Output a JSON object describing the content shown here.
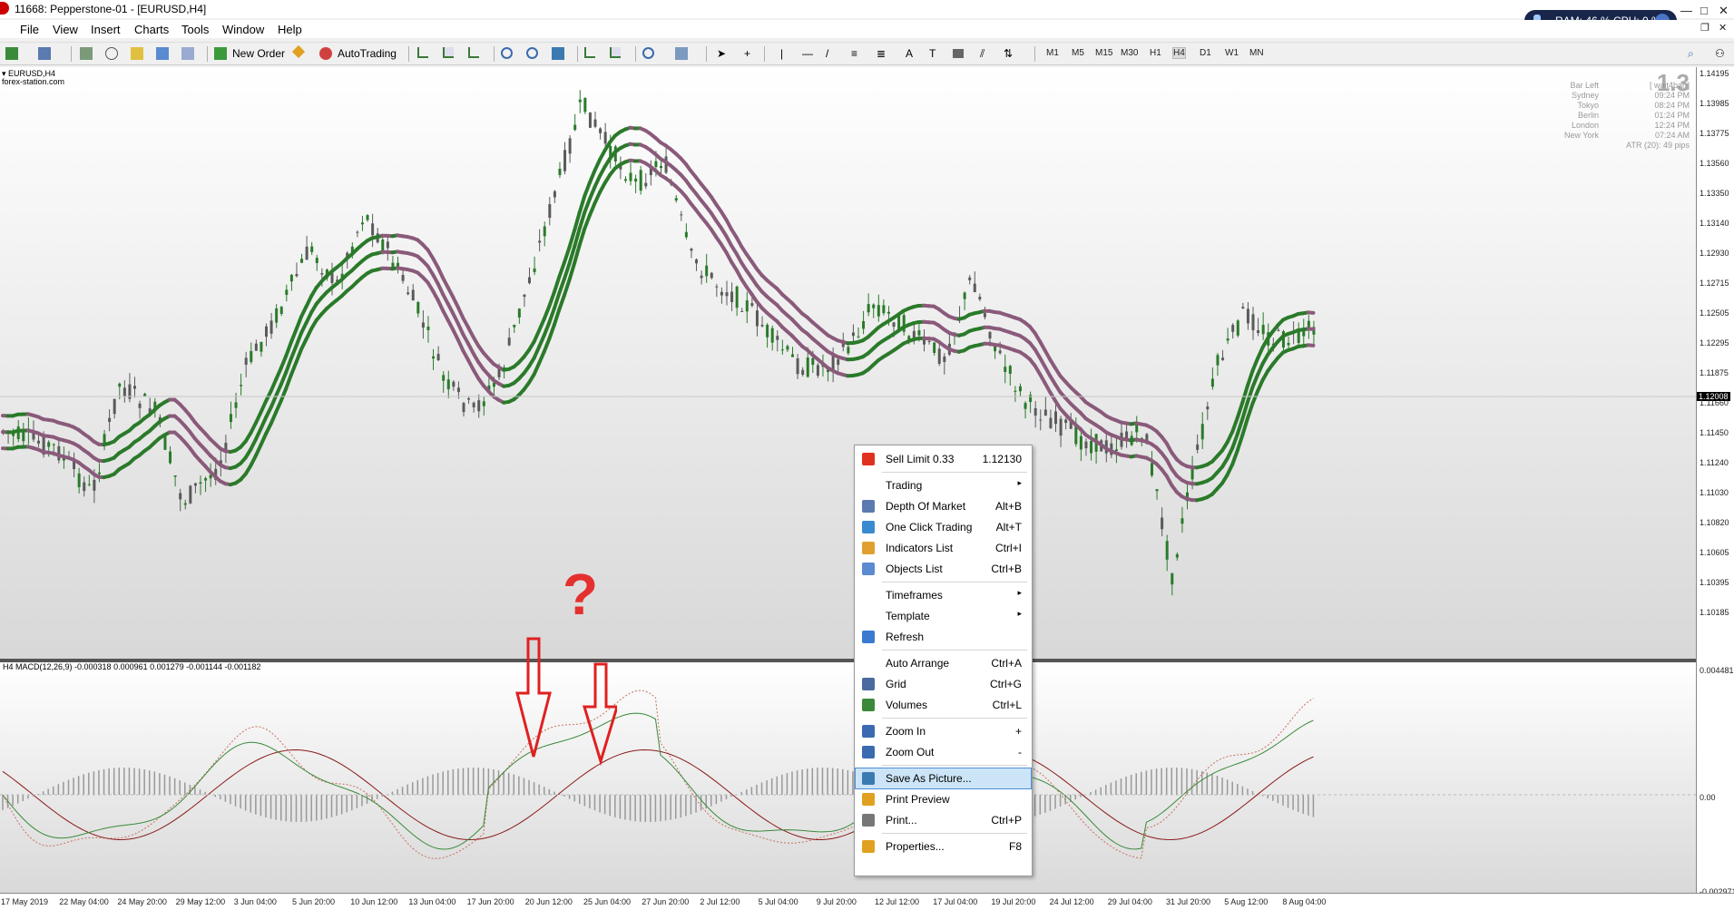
{
  "titlebar": {
    "title": "11668: Pepperstone-01 - [EURUSD,H4]"
  },
  "menu": [
    "File",
    "View",
    "Insert",
    "Charts",
    "Tools",
    "Window",
    "Help"
  ],
  "sysmon": {
    "text": "RAM: 46 %  CPU: 0 %",
    "arrow": "→"
  },
  "toolbar": {
    "new_order": "New Order",
    "auto_trading": "AutoTrading",
    "timeframes": [
      "M1",
      "M5",
      "M15",
      "M30",
      "H1",
      "H4",
      "D1",
      "W1",
      "MN"
    ],
    "active_tf": "H4"
  },
  "chart": {
    "symbol": "EURUSD,H4",
    "site": "forex-station.com",
    "macd_label": "H4 MACD(12,26,9) -0.000318 0.000961 0.001279 -0.001144 -0.001182",
    "big_value": "1.3",
    "info": [
      {
        "k": "Bar Left",
        "v": "[ wait4bar ]"
      },
      {
        "k": "Sydney",
        "v": "09:24 PM"
      },
      {
        "k": "Tokyo",
        "v": "08:24 PM"
      },
      {
        "k": "Berlin",
        "v": "01:24 PM"
      },
      {
        "k": "London",
        "v": "12:24 PM"
      },
      {
        "k": "New York",
        "v": "07:24 AM"
      },
      {
        "k": "",
        "v": "ATR (20): 49 pips"
      }
    ],
    "price_axis": [
      "1.14195",
      "1.13985",
      "1.13775",
      "1.13560",
      "1.13350",
      "1.13140",
      "1.12930",
      "1.12715",
      "1.12505",
      "1.12295",
      "1.12008",
      "1.11875",
      "1.11660",
      "1.11450",
      "1.11240",
      "1.11030",
      "1.10820",
      "1.10605",
      "1.10395",
      "1.10185"
    ],
    "current_price": "1.12008",
    "macd_axis": [
      "0.004481",
      "0.00",
      "-0.002971"
    ],
    "time_axis": [
      "17 May 2019",
      "22 May 04:00",
      "24 May 20:00",
      "29 May 12:00",
      "3 Jun 04:00",
      "5 Jun 20:00",
      "10 Jun 12:00",
      "13 Jun 04:00",
      "17 Jun 20:00",
      "20 Jun 12:00",
      "25 Jun 04:00",
      "27 Jun 20:00",
      "2 Jul 12:00",
      "5 Jul 04:00",
      "9 Jul 20:00",
      "12 Jul 12:00",
      "17 Jul 04:00",
      "19 Jul 20:00",
      "24 Jul 12:00",
      "29 Jul 04:00",
      "31 Jul 20:00",
      "5 Aug 12:00",
      "8 Aug 04:00"
    ],
    "annotation": "?",
    "colors": {
      "green": "#2a7a2a",
      "maroon": "#8a5a7a",
      "arrow": "#e02020",
      "macd_main": "#3a8a3a",
      "macd_signal": "#8a1a1a"
    }
  },
  "context_menu": {
    "items": [
      {
        "label": "Sell Limit 0.33",
        "shortcut": "1.12130",
        "icon": "sell-arrow-icon"
      },
      {
        "sep": true
      },
      {
        "label": "Trading",
        "submenu": true
      },
      {
        "label": "Depth Of Market",
        "shortcut": "Alt+B",
        "icon": "depth-of-market-icon"
      },
      {
        "label": "One Click Trading",
        "shortcut": "Alt+T",
        "icon": "one-click-trading-icon"
      },
      {
        "label": "Indicators List",
        "shortcut": "Ctrl+I",
        "icon": "indicators-list-icon"
      },
      {
        "label": "Objects List",
        "shortcut": "Ctrl+B",
        "icon": "objects-list-icon"
      },
      {
        "sep": true
      },
      {
        "label": "Timeframes",
        "submenu": true
      },
      {
        "label": "Template",
        "submenu": true
      },
      {
        "label": "Refresh",
        "icon": "refresh-icon"
      },
      {
        "sep": true
      },
      {
        "label": "Auto Arrange",
        "shortcut": "Ctrl+A"
      },
      {
        "label": "Grid",
        "shortcut": "Ctrl+G",
        "icon": "grid-icon"
      },
      {
        "label": "Volumes",
        "shortcut": "Ctrl+L",
        "icon": "volumes-icon"
      },
      {
        "sep": true
      },
      {
        "label": "Zoom In",
        "shortcut": "+",
        "icon": "zoom-in-icon"
      },
      {
        "label": "Zoom Out",
        "shortcut": "-",
        "icon": "zoom-out-icon"
      },
      {
        "sep": true
      },
      {
        "label": "Save As Picture...",
        "highlight": true,
        "icon": "save-picture-icon"
      },
      {
        "label": "Print Preview",
        "icon": "print-preview-icon"
      },
      {
        "label": "Print...",
        "shortcut": "Ctrl+P",
        "icon": "print-icon"
      },
      {
        "sep": true
      },
      {
        "label": "Properties...",
        "shortcut": "F8",
        "icon": "properties-icon"
      }
    ]
  }
}
